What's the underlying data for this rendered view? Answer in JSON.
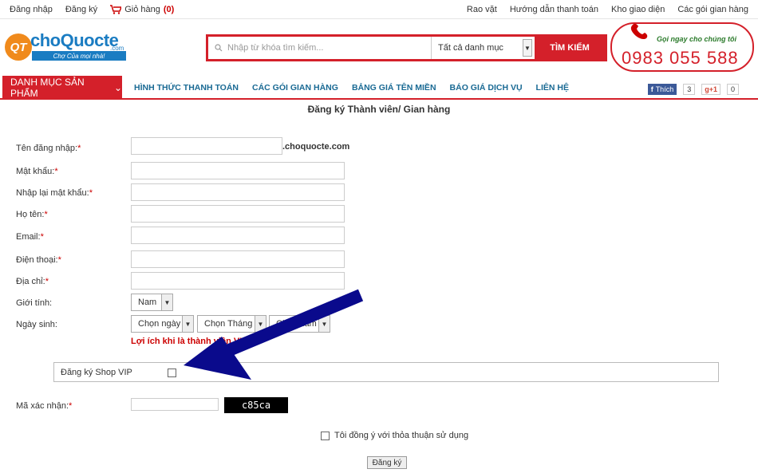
{
  "topbar": {
    "login": "Đăng nhập",
    "register": "Đăng ký",
    "cart_label": "Giỏ hàng",
    "cart_count": "(0)",
    "right_links": [
      "Rao vặt",
      "Hướng dẫn thanh toán",
      "Kho giao diện",
      "Các gói gian hàng"
    ]
  },
  "logo": {
    "mark": "QT",
    "name": "choQuocte",
    "domain": ".com",
    "slogan": "Chợ Của mọi nhà!"
  },
  "search": {
    "placeholder": "Nhập từ khóa tìm kiếm...",
    "category": "Tất cả danh mục",
    "button": "TÌM KIẾM"
  },
  "hotline": {
    "call": "Gọi ngay cho chúng tôi",
    "number": "0983 055 588"
  },
  "nav": {
    "categories": "DANH MỤC SẢN PHẨM",
    "links": [
      "HÌNH THỨC THANH TOÁN",
      "CÁC GÓI GIAN HÀNG",
      "BẢNG GIÁ TÊN MIỀN",
      "BÁO GIÁ DỊCH VỤ",
      "LIÊN HỆ"
    ]
  },
  "social": {
    "fb_label": "Thích",
    "fb_count": "3",
    "gp_label": "+1",
    "gp_count": "0"
  },
  "form": {
    "title": "Đăng ký Thành viên/ Gian hàng",
    "username_label": "Tên đăng nhập:",
    "domain_suffix": ".choquocte.com",
    "password_label": "Mật khẩu:",
    "repassword_label": "Nhập lại mật khẩu:",
    "fullname_label": "Họ tên:",
    "email_label": "Email:",
    "phone_label": "Điện thoại:",
    "address_label": "Địa chỉ:",
    "gender_label": "Giới tính:",
    "gender_value": "Nam",
    "birthday_label": "Ngày sinh:",
    "day_value": "Chọn ngày",
    "month_value": "Chọn Tháng",
    "year_value": "Chọn năm",
    "benefit_text": "Lợi ích khi là thành viên VIP",
    "vip_label": "Đăng ký Shop VIP",
    "captcha_label": "Mã xác nhận:",
    "captcha_code": "c85ca",
    "agree_label": "Tôi đồng ý với thỏa thuận sử dụng",
    "submit_label": "Đăng ký",
    "required_mark": "*"
  },
  "colors": {
    "brand_red": "#d4202a",
    "brand_blue": "#1a7cc2",
    "annotation_arrow": "#0a0a8c"
  }
}
